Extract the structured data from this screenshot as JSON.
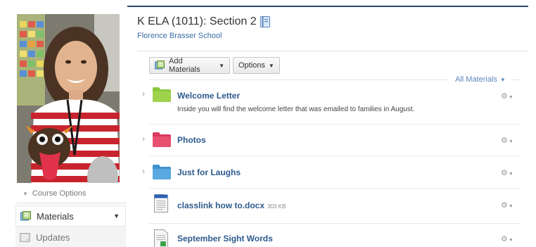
{
  "course": {
    "title": "K ELA (1011): Section 2",
    "school": "Florence Brasser School"
  },
  "sidebar": {
    "course_options": "Course Options",
    "items": [
      {
        "label": "Materials"
      },
      {
        "label": "Updates"
      }
    ]
  },
  "toolbar": {
    "add_materials": "Add Materials",
    "options": "Options",
    "filter": "All Materials"
  },
  "materials": [
    {
      "title": "Welcome Letter",
      "type": "folder",
      "color": "#8cc63f",
      "description": "Inside you will find the welcome letter that was emailed to families in August."
    },
    {
      "title": "Photos",
      "type": "folder",
      "color": "#e8506f"
    },
    {
      "title": "Just for Laughs",
      "type": "folder",
      "color": "#5aa9e0"
    },
    {
      "title": "classlink how to.docx",
      "type": "file",
      "size": "303 KB"
    },
    {
      "title": "September Sight Words",
      "type": "file"
    }
  ],
  "colors": {
    "link": "#2d5a8c",
    "header_rule": "#2a4a6e"
  }
}
